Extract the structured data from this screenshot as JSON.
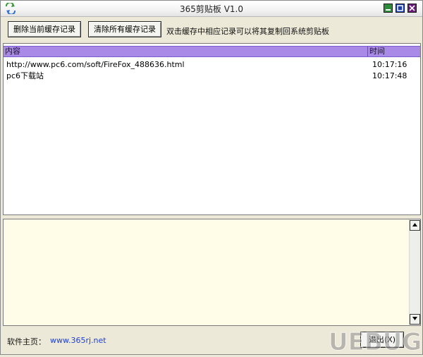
{
  "window": {
    "title": "365剪贴板 V1.0"
  },
  "toolbar": {
    "delete_current_label": "删除当前缓存记录",
    "clear_all_label": "清除所有缓存记录",
    "hint": "双击缓存中相应记录可以将其复制回系统剪贴板"
  },
  "list": {
    "columns": [
      "内容",
      "时间"
    ],
    "rows": [
      {
        "content": "http://www.pc6.com/soft/FireFox_488636.html",
        "time": "10:17:16"
      },
      {
        "content": "pc6下载站",
        "time": "10:17:48"
      }
    ]
  },
  "editor": {
    "value": ""
  },
  "status": {
    "home_label": "软件主页：",
    "home_url": "www.365rj.net",
    "exit_label": "退出(X)"
  },
  "watermark": {
    "text": "UEBUG"
  },
  "colors": {
    "header_bg": "#a98ae6",
    "editor_bg": "#fffde8",
    "link": "#1d3fd8",
    "minimize": "#2e8b3a",
    "maximize": "#1d3fa8",
    "close": "#6b1a7c"
  }
}
